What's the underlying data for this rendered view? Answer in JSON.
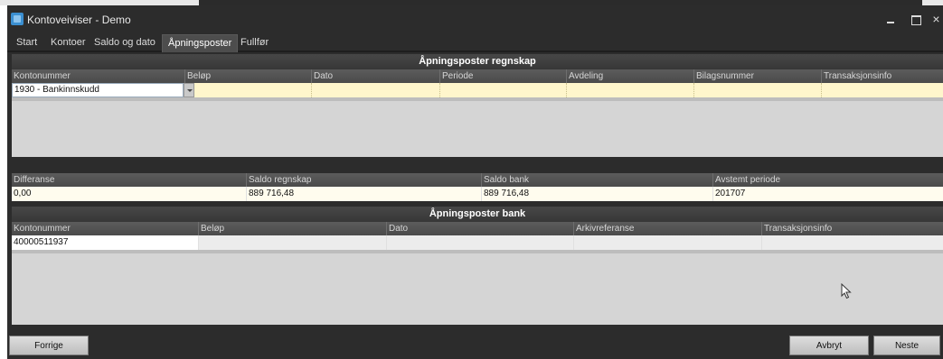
{
  "window": {
    "title": "Kontoveiviser - Demo",
    "controls": {
      "minimize": "–",
      "maximize": "□",
      "close": "×"
    }
  },
  "tabs": [
    {
      "label": "Start",
      "active": false
    },
    {
      "label": "Kontoer",
      "active": false
    },
    {
      "label": "Saldo og dato",
      "active": false
    },
    {
      "label": "Åpningsposter",
      "active": true
    },
    {
      "label": "Fullfør",
      "active": false
    }
  ],
  "regnskap": {
    "title": "Åpningsposter regnskap",
    "columns": [
      "Kontonummer",
      "Beløp",
      "Dato",
      "Periode",
      "Avdeling",
      "Bilagsnummer",
      "Transaksjonsinfo"
    ],
    "row": {
      "kontonummer": "1930 - Bankinnskudd",
      "belop": "",
      "dato": "",
      "periode": "",
      "avdeling": "",
      "bilagsnummer": "",
      "transaksjonsinfo": ""
    }
  },
  "summary": {
    "columns": [
      "Differanse",
      "Saldo regnskap",
      "Saldo bank",
      "Avstemt periode"
    ],
    "values": [
      "0,00",
      "889 716,48",
      "889 716,48",
      "201707"
    ]
  },
  "bank": {
    "title": "Åpningsposter bank",
    "columns": [
      "Kontonummer",
      "Beløp",
      "Dato",
      "Arkivreferanse",
      "Transaksjonsinfo"
    ],
    "row": [
      "40000511937",
      "",
      "",
      "",
      ""
    ]
  },
  "footer": {
    "prev_label": "Forrige",
    "cancel_label": "Avbryt",
    "next_label": "Neste"
  },
  "colors": {
    "window_bg": "#2c2c2c",
    "header_bg": "#4a4a4a",
    "selected_row": "#fff6cc",
    "empty_area": "#d5d5d5"
  }
}
